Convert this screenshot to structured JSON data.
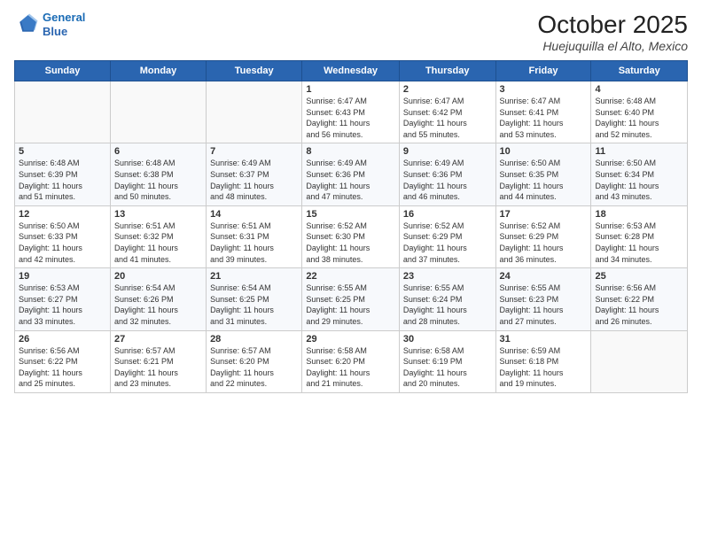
{
  "header": {
    "logo_line1": "General",
    "logo_line2": "Blue",
    "month_title": "October 2025",
    "location": "Huejuquilla el Alto, Mexico"
  },
  "days_of_week": [
    "Sunday",
    "Monday",
    "Tuesday",
    "Wednesday",
    "Thursday",
    "Friday",
    "Saturday"
  ],
  "weeks": [
    [
      {
        "num": "",
        "info": ""
      },
      {
        "num": "",
        "info": ""
      },
      {
        "num": "",
        "info": ""
      },
      {
        "num": "1",
        "info": "Sunrise: 6:47 AM\nSunset: 6:43 PM\nDaylight: 11 hours\nand 56 minutes."
      },
      {
        "num": "2",
        "info": "Sunrise: 6:47 AM\nSunset: 6:42 PM\nDaylight: 11 hours\nand 55 minutes."
      },
      {
        "num": "3",
        "info": "Sunrise: 6:47 AM\nSunset: 6:41 PM\nDaylight: 11 hours\nand 53 minutes."
      },
      {
        "num": "4",
        "info": "Sunrise: 6:48 AM\nSunset: 6:40 PM\nDaylight: 11 hours\nand 52 minutes."
      }
    ],
    [
      {
        "num": "5",
        "info": "Sunrise: 6:48 AM\nSunset: 6:39 PM\nDaylight: 11 hours\nand 51 minutes."
      },
      {
        "num": "6",
        "info": "Sunrise: 6:48 AM\nSunset: 6:38 PM\nDaylight: 11 hours\nand 50 minutes."
      },
      {
        "num": "7",
        "info": "Sunrise: 6:49 AM\nSunset: 6:37 PM\nDaylight: 11 hours\nand 48 minutes."
      },
      {
        "num": "8",
        "info": "Sunrise: 6:49 AM\nSunset: 6:36 PM\nDaylight: 11 hours\nand 47 minutes."
      },
      {
        "num": "9",
        "info": "Sunrise: 6:49 AM\nSunset: 6:36 PM\nDaylight: 11 hours\nand 46 minutes."
      },
      {
        "num": "10",
        "info": "Sunrise: 6:50 AM\nSunset: 6:35 PM\nDaylight: 11 hours\nand 44 minutes."
      },
      {
        "num": "11",
        "info": "Sunrise: 6:50 AM\nSunset: 6:34 PM\nDaylight: 11 hours\nand 43 minutes."
      }
    ],
    [
      {
        "num": "12",
        "info": "Sunrise: 6:50 AM\nSunset: 6:33 PM\nDaylight: 11 hours\nand 42 minutes."
      },
      {
        "num": "13",
        "info": "Sunrise: 6:51 AM\nSunset: 6:32 PM\nDaylight: 11 hours\nand 41 minutes."
      },
      {
        "num": "14",
        "info": "Sunrise: 6:51 AM\nSunset: 6:31 PM\nDaylight: 11 hours\nand 39 minutes."
      },
      {
        "num": "15",
        "info": "Sunrise: 6:52 AM\nSunset: 6:30 PM\nDaylight: 11 hours\nand 38 minutes."
      },
      {
        "num": "16",
        "info": "Sunrise: 6:52 AM\nSunset: 6:29 PM\nDaylight: 11 hours\nand 37 minutes."
      },
      {
        "num": "17",
        "info": "Sunrise: 6:52 AM\nSunset: 6:29 PM\nDaylight: 11 hours\nand 36 minutes."
      },
      {
        "num": "18",
        "info": "Sunrise: 6:53 AM\nSunset: 6:28 PM\nDaylight: 11 hours\nand 34 minutes."
      }
    ],
    [
      {
        "num": "19",
        "info": "Sunrise: 6:53 AM\nSunset: 6:27 PM\nDaylight: 11 hours\nand 33 minutes."
      },
      {
        "num": "20",
        "info": "Sunrise: 6:54 AM\nSunset: 6:26 PM\nDaylight: 11 hours\nand 32 minutes."
      },
      {
        "num": "21",
        "info": "Sunrise: 6:54 AM\nSunset: 6:25 PM\nDaylight: 11 hours\nand 31 minutes."
      },
      {
        "num": "22",
        "info": "Sunrise: 6:55 AM\nSunset: 6:25 PM\nDaylight: 11 hours\nand 29 minutes."
      },
      {
        "num": "23",
        "info": "Sunrise: 6:55 AM\nSunset: 6:24 PM\nDaylight: 11 hours\nand 28 minutes."
      },
      {
        "num": "24",
        "info": "Sunrise: 6:55 AM\nSunset: 6:23 PM\nDaylight: 11 hours\nand 27 minutes."
      },
      {
        "num": "25",
        "info": "Sunrise: 6:56 AM\nSunset: 6:22 PM\nDaylight: 11 hours\nand 26 minutes."
      }
    ],
    [
      {
        "num": "26",
        "info": "Sunrise: 6:56 AM\nSunset: 6:22 PM\nDaylight: 11 hours\nand 25 minutes."
      },
      {
        "num": "27",
        "info": "Sunrise: 6:57 AM\nSunset: 6:21 PM\nDaylight: 11 hours\nand 23 minutes."
      },
      {
        "num": "28",
        "info": "Sunrise: 6:57 AM\nSunset: 6:20 PM\nDaylight: 11 hours\nand 22 minutes."
      },
      {
        "num": "29",
        "info": "Sunrise: 6:58 AM\nSunset: 6:20 PM\nDaylight: 11 hours\nand 21 minutes."
      },
      {
        "num": "30",
        "info": "Sunrise: 6:58 AM\nSunset: 6:19 PM\nDaylight: 11 hours\nand 20 minutes."
      },
      {
        "num": "31",
        "info": "Sunrise: 6:59 AM\nSunset: 6:18 PM\nDaylight: 11 hours\nand 19 minutes."
      },
      {
        "num": "",
        "info": ""
      }
    ]
  ]
}
